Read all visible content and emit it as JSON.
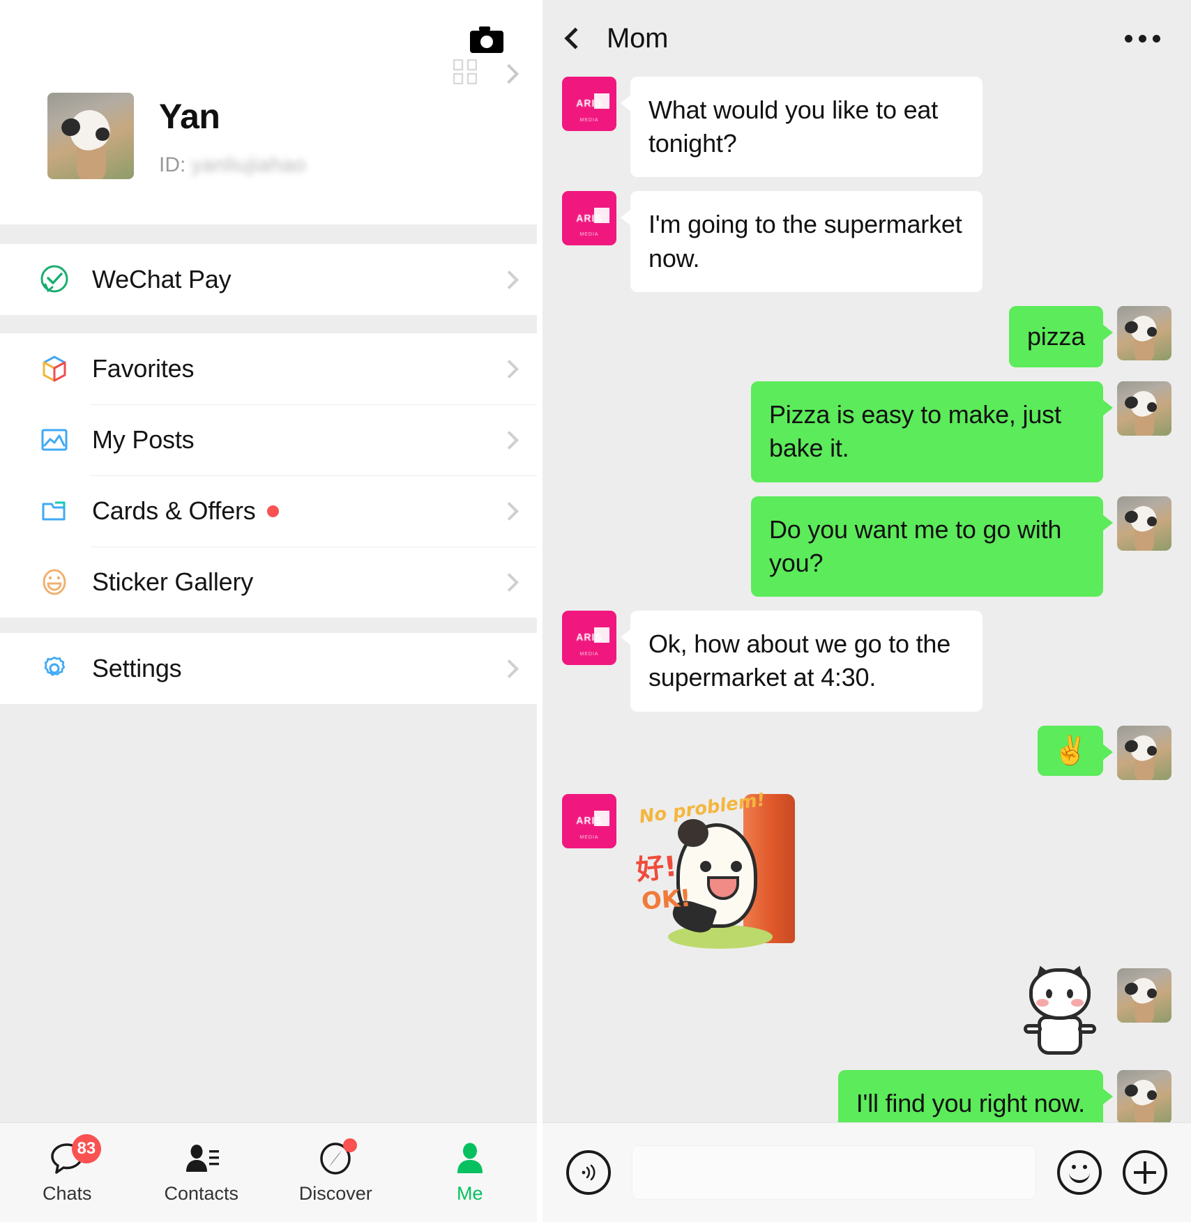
{
  "left": {
    "camera_icon": "camera-icon",
    "profile": {
      "name": "Yan",
      "id_label": "ID:",
      "id_value": "yanliujiahao",
      "qr_icon": "qr-code-icon",
      "chevron_icon": "chevron-right-icon"
    },
    "menu_groups": [
      {
        "items": [
          {
            "label": "WeChat Pay",
            "icon": "wechat-pay-icon",
            "badge": false
          }
        ]
      },
      {
        "items": [
          {
            "label": "Favorites",
            "icon": "favorites-box-icon",
            "badge": false
          },
          {
            "label": "My Posts",
            "icon": "my-posts-photo-icon",
            "badge": false
          },
          {
            "label": "Cards & Offers",
            "icon": "cards-offers-icon",
            "badge": true
          },
          {
            "label": "Sticker Gallery",
            "icon": "sticker-smiley-icon",
            "badge": false
          }
        ]
      },
      {
        "items": [
          {
            "label": "Settings",
            "icon": "settings-gear-icon",
            "badge": false
          }
        ]
      }
    ],
    "tabbar": [
      {
        "label": "Chats",
        "icon": "chat-bubble-icon",
        "badge_count": "83",
        "dot": false,
        "active": false
      },
      {
        "label": "Contacts",
        "icon": "contacts-person-icon",
        "badge_count": "",
        "dot": false,
        "active": false
      },
      {
        "label": "Discover",
        "icon": "discover-compass-icon",
        "badge_count": "",
        "dot": true,
        "active": false
      },
      {
        "label": "Me",
        "icon": "me-person-icon",
        "badge_count": "",
        "dot": false,
        "active": true
      }
    ]
  },
  "right": {
    "header": {
      "back_icon": "back-chevron-icon",
      "title": "Mom",
      "more_icon": "more-dots-icon"
    },
    "contact_avatar_text": "ARIS",
    "contact_avatar_sub": "MEDIA",
    "messages": [
      {
        "side": "in",
        "type": "text",
        "text": "What would you like to eat tonight?"
      },
      {
        "side": "in",
        "type": "text",
        "text": "I'm going to the supermarket now."
      },
      {
        "side": "out",
        "type": "text",
        "text": "pizza"
      },
      {
        "side": "out",
        "type": "text",
        "text": "Pizza is easy to make, just bake it."
      },
      {
        "side": "out",
        "type": "text",
        "text": "Do you want me to go with you?"
      },
      {
        "side": "in",
        "type": "text",
        "text": "Ok, how about we go to the supermarket at 4:30."
      },
      {
        "side": "out",
        "type": "emoji",
        "text": "✌"
      },
      {
        "side": "in",
        "type": "sticker",
        "sticker_texts": [
          "No problem!",
          "好!",
          "OK!"
        ]
      },
      {
        "side": "out",
        "type": "cat-sticker",
        "text": ""
      },
      {
        "side": "out",
        "type": "text",
        "text": "I'll find you right now."
      }
    ],
    "input_bar": {
      "voice_icon": "voice-input-icon",
      "input_placeholder": "",
      "input_value": "",
      "emoji_icon": "emoji-smiley-icon",
      "plus_icon": "plus-more-icon"
    }
  },
  "colors": {
    "accent_green": "#07c160",
    "bubble_green": "#5ceb5a",
    "badge_red": "#fa5151",
    "avatar_pink": "#f0187f",
    "app_bg": "#ededed"
  }
}
